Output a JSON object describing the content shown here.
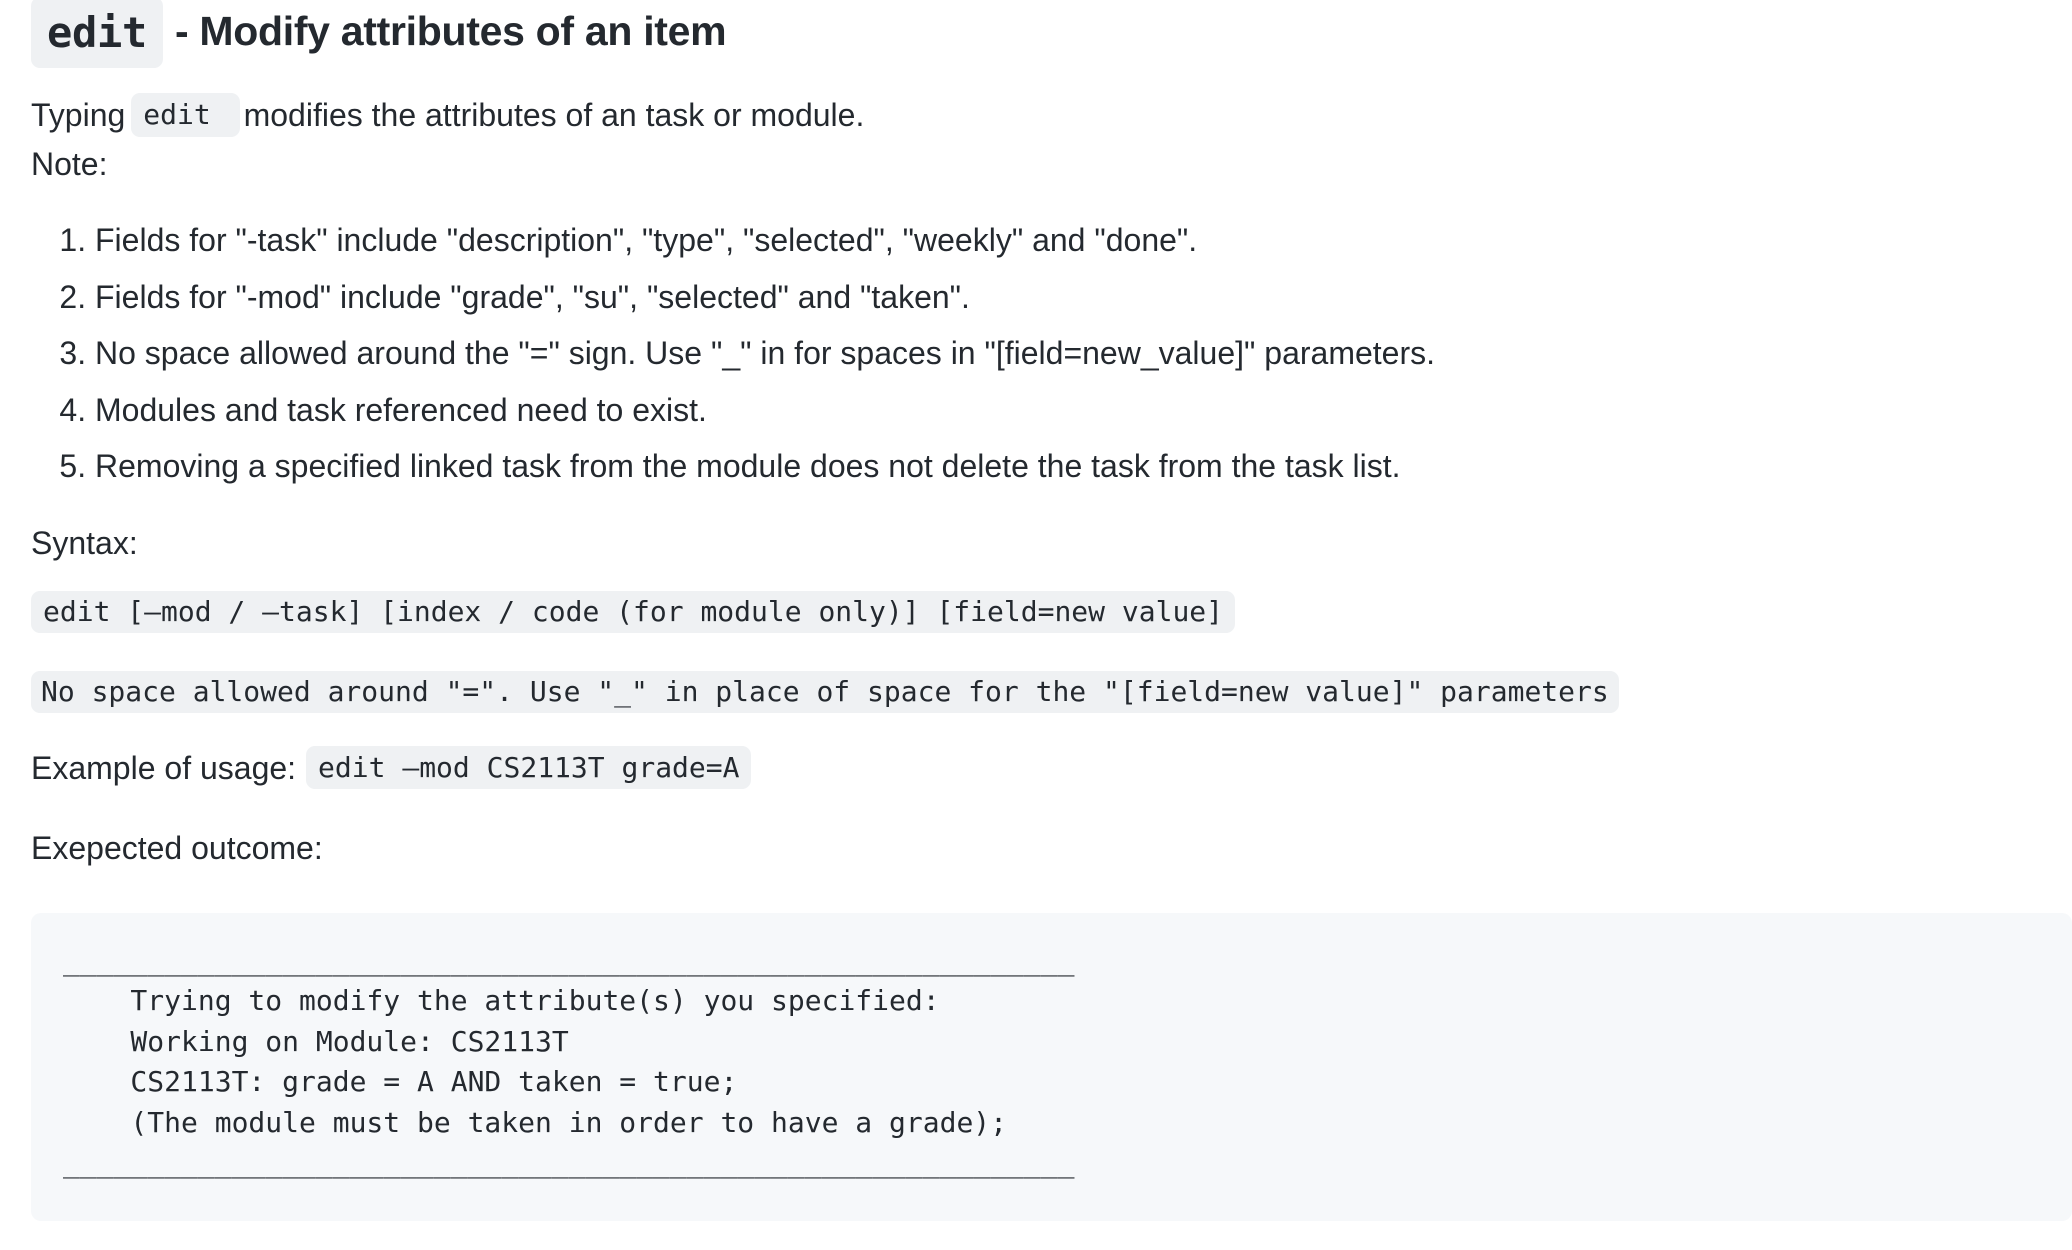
{
  "heading": {
    "command": "edit",
    "title": " - Modify attributes of an item"
  },
  "intro": {
    "prefix": "Typing",
    "command": "edit ",
    "suffix": "modifies the attributes of an task or module."
  },
  "note_label": "Note:",
  "notes": [
    "Fields for \"-task\" include \"description\", \"type\", \"selected\", \"weekly\" and \"done\".",
    "Fields for \"-mod\" include \"grade\", \"su\", \"selected\" and \"taken\".",
    "No space allowed around the \"=\" sign. Use \"_\" in for spaces in \"[field=new_value]\" parameters.",
    "Modules and task referenced need to exist.",
    "Removing a specified linked task from the module does not delete the task from the task list."
  ],
  "syntax_label": "Syntax:",
  "syntax_code": "edit [–mod / –task] [index / code (for module only)] [field=new value]",
  "syntax_note": "No space allowed around \"=\". Use \"_\" in place of space for the \"[field=new value]\" parameters",
  "example": {
    "label": "Example of usage:",
    "code": "edit –mod CS2113T grade=A"
  },
  "outcome_label": "Exepected outcome:",
  "outcome_lines": [
    "____________________________________________________________",
    "    Trying to modify the attribute(s) you specified:",
    "    Working on Module: CS2113T",
    "    CS2113T: grade = A AND taken = true;",
    "    (The module must be taken in order to have a grade);",
    "____________________________________________________________"
  ]
}
